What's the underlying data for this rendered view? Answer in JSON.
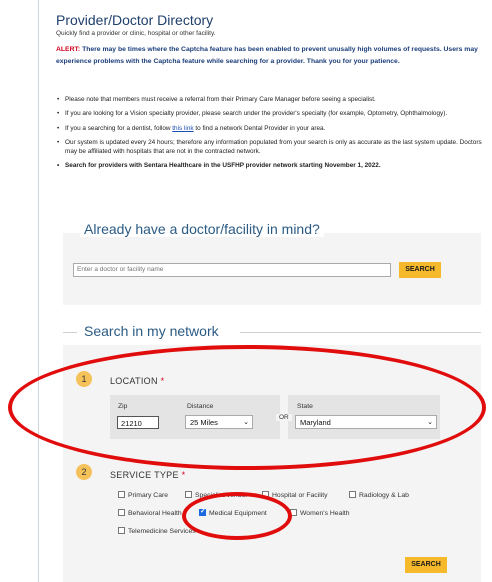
{
  "header": {
    "title": "Provider/Doctor Directory",
    "subtitle": "Quickly find a provider or clinic, hospital or other facility."
  },
  "alert": {
    "label": "ALERT:",
    "text": "There may be times where the Captcha feature has been enabled to prevent unusally high volumes of requests.  Users may experience problems with the Captcha feature while searching for a provider. Thank you for your patience."
  },
  "bullets": {
    "b1": "Please note that members must receive a referral from their Primary Care Manager before seeing a specialist.",
    "b2": "If you are looking for a Vision specialty provider, please search under the provider's specialty (for example, Optometry, Ophthalmology).",
    "b3_pre": "If you a searching for a dentist, follow ",
    "b3_link": "this link",
    "b3_post": " to find a network Dental Provider in your area.",
    "b4": "Our system is updated every 24 hours; therefore any information populated from your search is only as accurate as the last system update. Doctors may be affiliated with hospitals that are not in the contracted network.",
    "b5": "Search for providers with Sentara Healthcare in the USFHP provider network starting November 1, 2022."
  },
  "quick_search": {
    "heading": "Already have a doctor/facility in mind?",
    "placeholder": "Enter a doctor or facility name",
    "button": "SEARCH"
  },
  "network_search": {
    "heading": "Search in my network",
    "step1": {
      "num": "1",
      "label": "LOCATION",
      "required": "*"
    },
    "zip_label": "Zip",
    "zip_value": "21210",
    "distance_label": "Distance",
    "distance_value": "25 Miles",
    "or": "OR",
    "state_label": "State",
    "state_value": "Maryland",
    "step2": {
      "num": "2",
      "label": "SERVICE TYPE",
      "required": "*"
    },
    "services": {
      "primary_care": "Primary Care",
      "specialist": "Specialist/Vendor",
      "hospital": "Hospital or Facility",
      "radiology": "Radiology & Lab",
      "behavioral": "Behavioral Health",
      "medical_equipment": "Medical Equipment",
      "womens": "Women's Health",
      "telemedicine": "Telemedicine Services"
    },
    "button": "SEARCH"
  },
  "colors": {
    "accent_button": "#f5b92b",
    "alert_label": "#d0021b",
    "annotation_ring": "#e10d0d"
  }
}
